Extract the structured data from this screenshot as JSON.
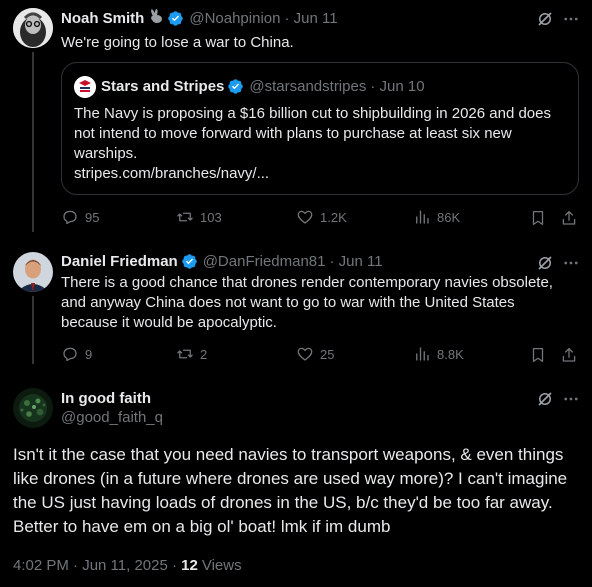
{
  "tweet1": {
    "name": "Noah Smith",
    "handle": "@Noahpinion",
    "date": "· Jun 11",
    "text": "We're going to lose a war to China.",
    "quote": {
      "name": "Stars and Stripes",
      "handle": "@starsandstripes",
      "date": "· Jun 10",
      "text": "The Navy is proposing a $16 billion cut to shipbuilding in 2026 and does not intend to move forward with plans to purchase at least six new warships.",
      "link": "stripes.com/branches/navy/..."
    },
    "replies": "95",
    "reposts": "103",
    "likes": "1.2K",
    "views": "86K"
  },
  "tweet2": {
    "name": "Daniel Friedman",
    "handle": "@DanFriedman81",
    "date": "· Jun 11",
    "text": "There is a good chance that drones render contemporary navies obsolete, and anyway China does not want to go to war with the United States because it would be apocalyptic.",
    "replies": "9",
    "reposts": "2",
    "likes": "25",
    "views": "8.8K"
  },
  "tweet3": {
    "name": "In good faith",
    "handle": "@good_faith_q",
    "text": "Isn't it the case that you need navies to transport  weapons, & even things like drones (in a future where drones are used way more)? I can't imagine the US just having loads of drones in the US, b/c they'd be too far away. Better to have em on a big ol' boat! lmk if im dumb",
    "timestamp": "4:02 PM · Jun 11, 2025 · ",
    "views_count": "12",
    "views_label": "Views"
  },
  "colors": {
    "background": "#000000",
    "text": "#e7e9ea",
    "muted": "#71767b",
    "verified": "#1d9bf0",
    "border": "#2f3336"
  },
  "icons": [
    "verified-badge",
    "grok-icon",
    "more-icon",
    "reply-icon",
    "repost-icon",
    "like-icon",
    "views-icon",
    "bookmark-icon",
    "share-icon",
    "bunny-emoji"
  ]
}
